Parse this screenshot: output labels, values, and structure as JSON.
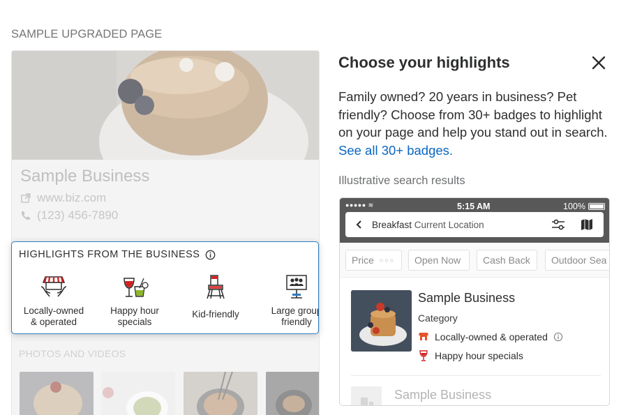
{
  "left": {
    "section_label": "SAMPLE UPGRADED PAGE",
    "business": {
      "name": "Sample Business",
      "website": "www.biz.com",
      "phone": "(123) 456-7890"
    },
    "highlights": {
      "title": "HIGHLIGHTS FROM THE BUSINESS",
      "items": [
        {
          "label": "Locally-owned\n& operated",
          "icon": "storefront-hands-icon"
        },
        {
          "label": "Happy hour\nspecials",
          "icon": "cocktail-glasses-icon"
        },
        {
          "label": "Kid-friendly",
          "icon": "high-chair-icon"
        },
        {
          "label": "Large group\nfriendly",
          "icon": "group-sign-icon"
        }
      ]
    },
    "photos_label": "PHOTOS AND VIDEOS"
  },
  "panel": {
    "title": "Choose your highlights",
    "description": "Family owned? 20 years in business? Pet friendly? Choose from 30+ badges to highlight on your page and help you stand out in search.",
    "link_text": "See all 30+ badges.",
    "illustrative_label": "Illustrative search results",
    "phone": {
      "time": "5:15 AM",
      "battery": "100%",
      "search_term": "Breakfast",
      "search_location": "Current Location",
      "filters": [
        "Price",
        "Open Now",
        "Cash Back",
        "Outdoor Sea"
      ],
      "result": {
        "name": "Sample Business",
        "category": "Category",
        "highlights": [
          "Locally-owned & operated",
          "Happy hour specials"
        ]
      },
      "result2_name": "Sample Business"
    }
  },
  "colors": {
    "accent_blue": "#2e7bc0",
    "link": "#0a66c2",
    "status_bar": "#585858",
    "highlight_red": "#d32323"
  }
}
